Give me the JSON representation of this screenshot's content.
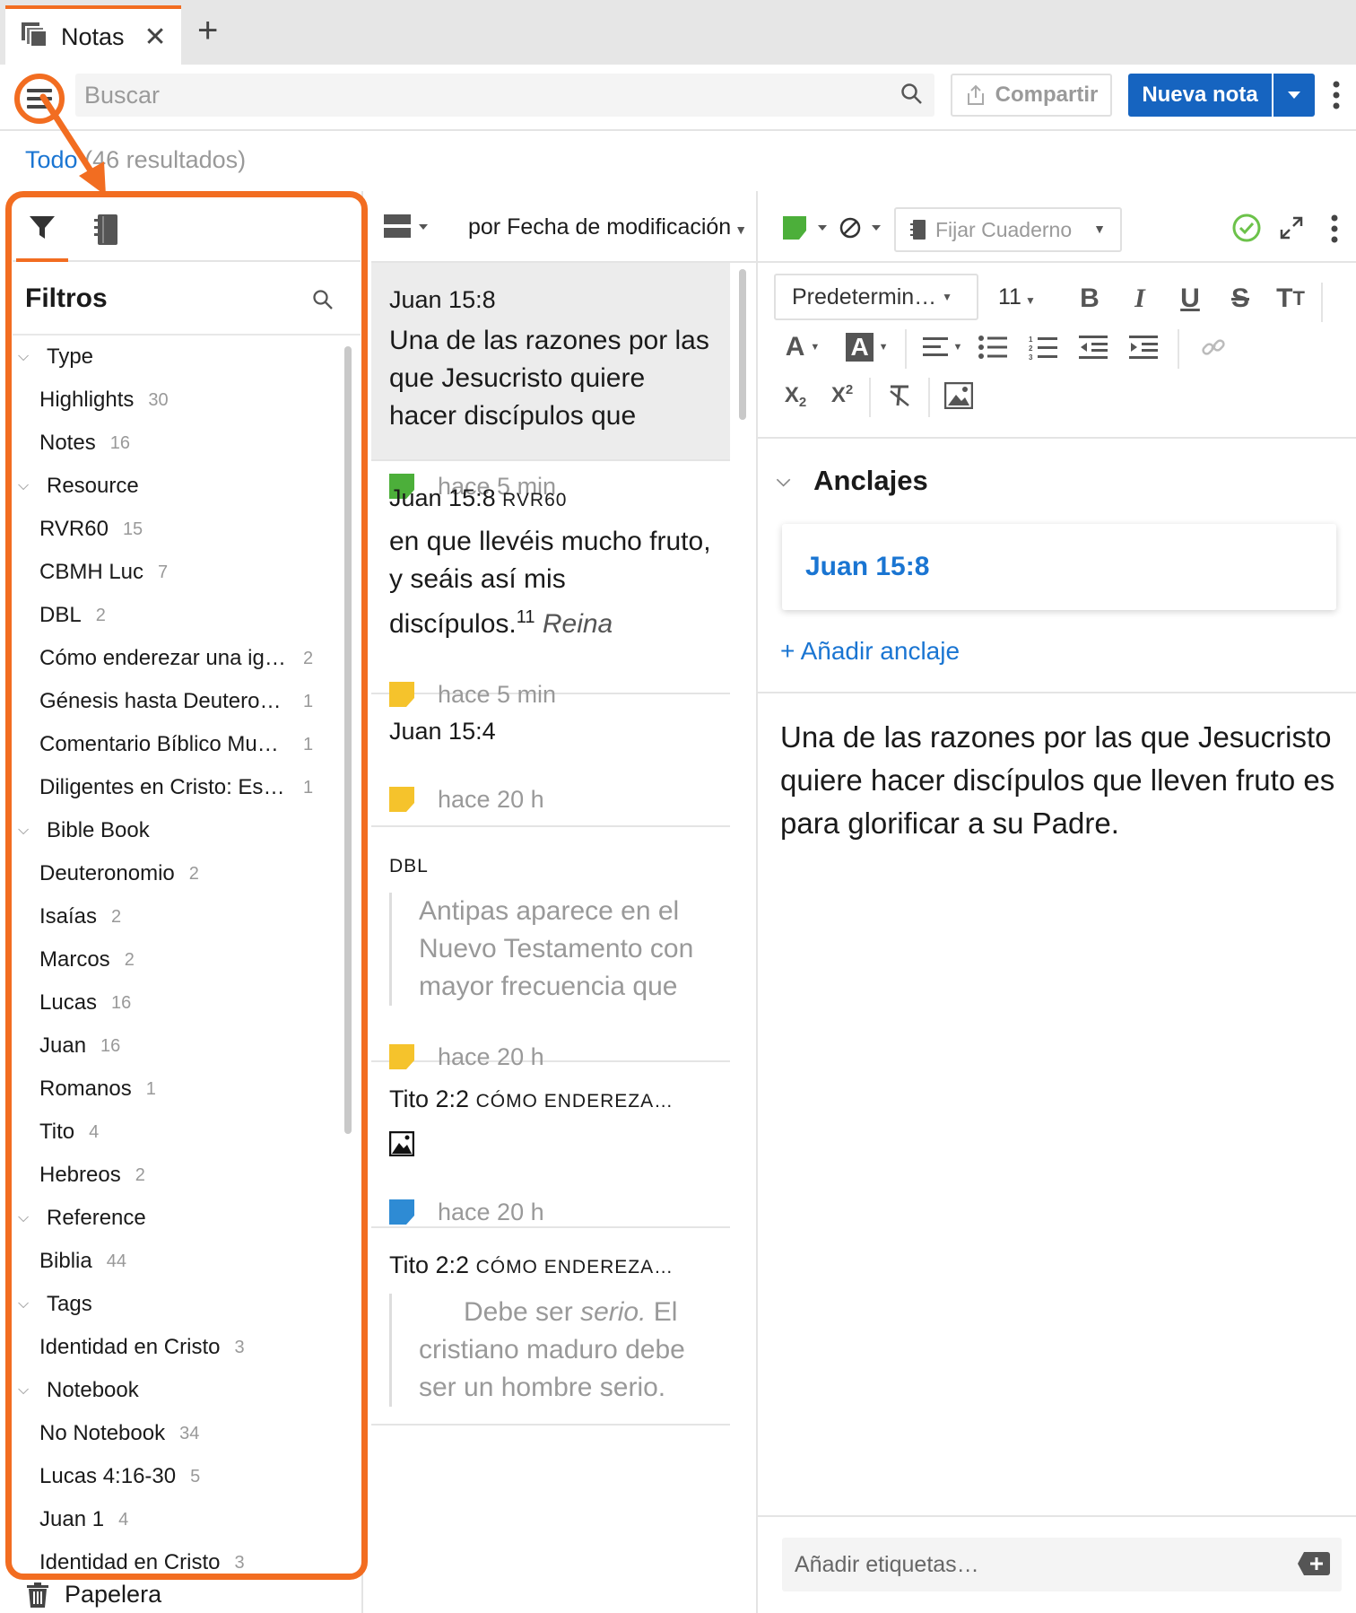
{
  "tab": {
    "title": "Notas",
    "close": "✕",
    "new": "+"
  },
  "toolbar": {
    "search_placeholder": "Buscar",
    "share_label": "Compartir",
    "new_note_label": "Nueva nota"
  },
  "results": {
    "all_label": "Todo",
    "count_label": "(46 resultados)"
  },
  "filters": {
    "title": "Filtros",
    "groups": [
      {
        "label": "Type",
        "items": [
          {
            "label": "Highlights",
            "count": "30"
          },
          {
            "label": "Notes",
            "count": "16"
          }
        ]
      },
      {
        "label": "Resource",
        "items": [
          {
            "label": "RVR60",
            "count": "15"
          },
          {
            "label": "CBMH Luc",
            "count": "7"
          },
          {
            "label": "DBL",
            "count": "2"
          },
          {
            "label": "Cómo enderezar una ig…",
            "count": "2"
          },
          {
            "label": "Génesis hasta Deutero…",
            "count": "1"
          },
          {
            "label": "Comentario Bíblico Mu…",
            "count": "1"
          },
          {
            "label": "Diligentes en Cristo: Est…",
            "count": "1"
          }
        ]
      },
      {
        "label": "Bible Book",
        "items": [
          {
            "label": "Deuteronomio",
            "count": "2"
          },
          {
            "label": "Isaías",
            "count": "2"
          },
          {
            "label": "Marcos",
            "count": "2"
          },
          {
            "label": "Lucas",
            "count": "16"
          },
          {
            "label": "Juan",
            "count": "16"
          },
          {
            "label": "Romanos",
            "count": "1"
          },
          {
            "label": "Tito",
            "count": "4"
          },
          {
            "label": "Hebreos",
            "count": "2"
          }
        ]
      },
      {
        "label": "Reference",
        "items": [
          {
            "label": "Biblia",
            "count": "44"
          }
        ]
      },
      {
        "label": "Tags",
        "items": [
          {
            "label": "Identidad en Cristo",
            "count": "3"
          }
        ]
      },
      {
        "label": "Notebook",
        "items": [
          {
            "label": "No Notebook",
            "count": "34"
          },
          {
            "label": "Lucas 4:16-30",
            "count": "5"
          },
          {
            "label": "Juan 1",
            "count": "4"
          },
          {
            "label": "Identidad en Cristo",
            "count": "3"
          }
        ]
      }
    ],
    "trash_label": "Papelera"
  },
  "list": {
    "sort_label": "por Fecha de modificación",
    "notes": [
      {
        "title": "Juan 15:8",
        "body": "Una de las razones por las que Jesucristo quiere hacer discípulos que",
        "time": "hace 5 min",
        "color": "#4caf3a",
        "selected": true
      },
      {
        "title": "Juan 15:8",
        "title_sc": "RVR60",
        "body": "en que llevéis mucho fruto, y seáis así mis discípulos.",
        "sup": "11",
        "body_italic": "Reina",
        "time": "hace 5 min",
        "color": "#f5c32c"
      },
      {
        "title": "Juan 15:4",
        "time": "hace 20 h",
        "color": "#f5c32c"
      },
      {
        "title_sc": "DBL",
        "quote": "Antipas aparece en el Nuevo Testamento con mayor frecuencia que",
        "time": "hace 20 h",
        "color": "#f5c32c"
      },
      {
        "title": "Tito 2:2",
        "title_sc": "CÓMO ENDEREZA…",
        "time": "hace 20 h",
        "color": "#2e8bd4",
        "has_image": true
      },
      {
        "title": "Tito 2:2",
        "title_sc": "CÓMO ENDEREZA…",
        "quote_pre": "Debe ser ",
        "quote_italic": "serio.",
        "quote_post": " El cristiano maduro debe ser un hombre serio."
      }
    ]
  },
  "editor": {
    "pin_notebook": "Fijar Cuaderno",
    "font_family": "Predetermin…",
    "font_size": "11",
    "anchors_title": "Anclajes",
    "anchor": "Juan 15:8",
    "add_anchor": "+ Añadir anclaje",
    "body": "Una de las razones por las que Jesucristo quiere hacer discípulos que lleven fruto es para glorificar a su Padre.",
    "tags_placeholder": "Añadir etiquetas…"
  },
  "colors": {
    "accent": "#f26d21",
    "primary": "#1664c0",
    "link": "#1a75d2"
  }
}
